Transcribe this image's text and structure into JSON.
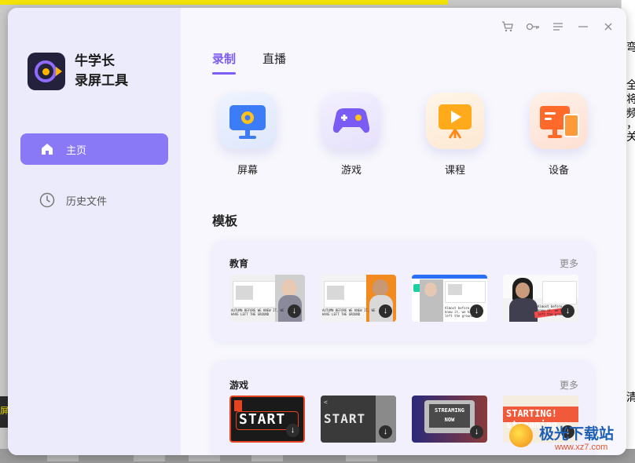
{
  "app": {
    "name_line1": "牛学长",
    "name_line2": "录屏工具"
  },
  "sidebar": {
    "items": [
      {
        "label": "主页",
        "icon": "home-icon"
      },
      {
        "label": "历史文件",
        "icon": "clock-icon"
      }
    ]
  },
  "window_controls": [
    "cart-icon",
    "key-icon",
    "menu-icon",
    "minimize-icon",
    "close-icon"
  ],
  "tabs": [
    {
      "label": "录制",
      "active": true
    },
    {
      "label": "直播",
      "active": false
    }
  ],
  "modes": [
    {
      "label": "屏幕",
      "icon": "monitor-icon"
    },
    {
      "label": "游戏",
      "icon": "gamepad-icon"
    },
    {
      "label": "课程",
      "icon": "course-play-icon"
    },
    {
      "label": "设备",
      "icon": "device-icon"
    }
  ],
  "templates": {
    "title": "模板",
    "sections": [
      {
        "title": "教育",
        "more": "更多",
        "thumbs": [
          "AUTUMN BEFORE WE KNEW IT, WE HAVE LEFT THE GROUND",
          "AUTUMN BEFORE WE KNEW IT, WE HAVE LEFT THE GROUND",
          "Almost before we knew it, we had left the ground.",
          "Almost before we knew it, we had left the ground."
        ]
      },
      {
        "title": "游戏",
        "more": "更多",
        "thumbs": [
          "START",
          "START",
          "STREAMING NOW",
          "STARTING! streaming"
        ]
      }
    ]
  },
  "background": {
    "right_glyphs": [
      "弯",
      "全",
      "将",
      "频",
      "，",
      "关",
      "清"
    ],
    "left_glyph": "屏",
    "watermark_title": "极光下载站",
    "watermark_url": "www.xz7.com"
  },
  "colors": {
    "accent": "#7b5cf5",
    "nav_active": "#8a79f7",
    "sidebar_bg": "#ecebfb"
  }
}
